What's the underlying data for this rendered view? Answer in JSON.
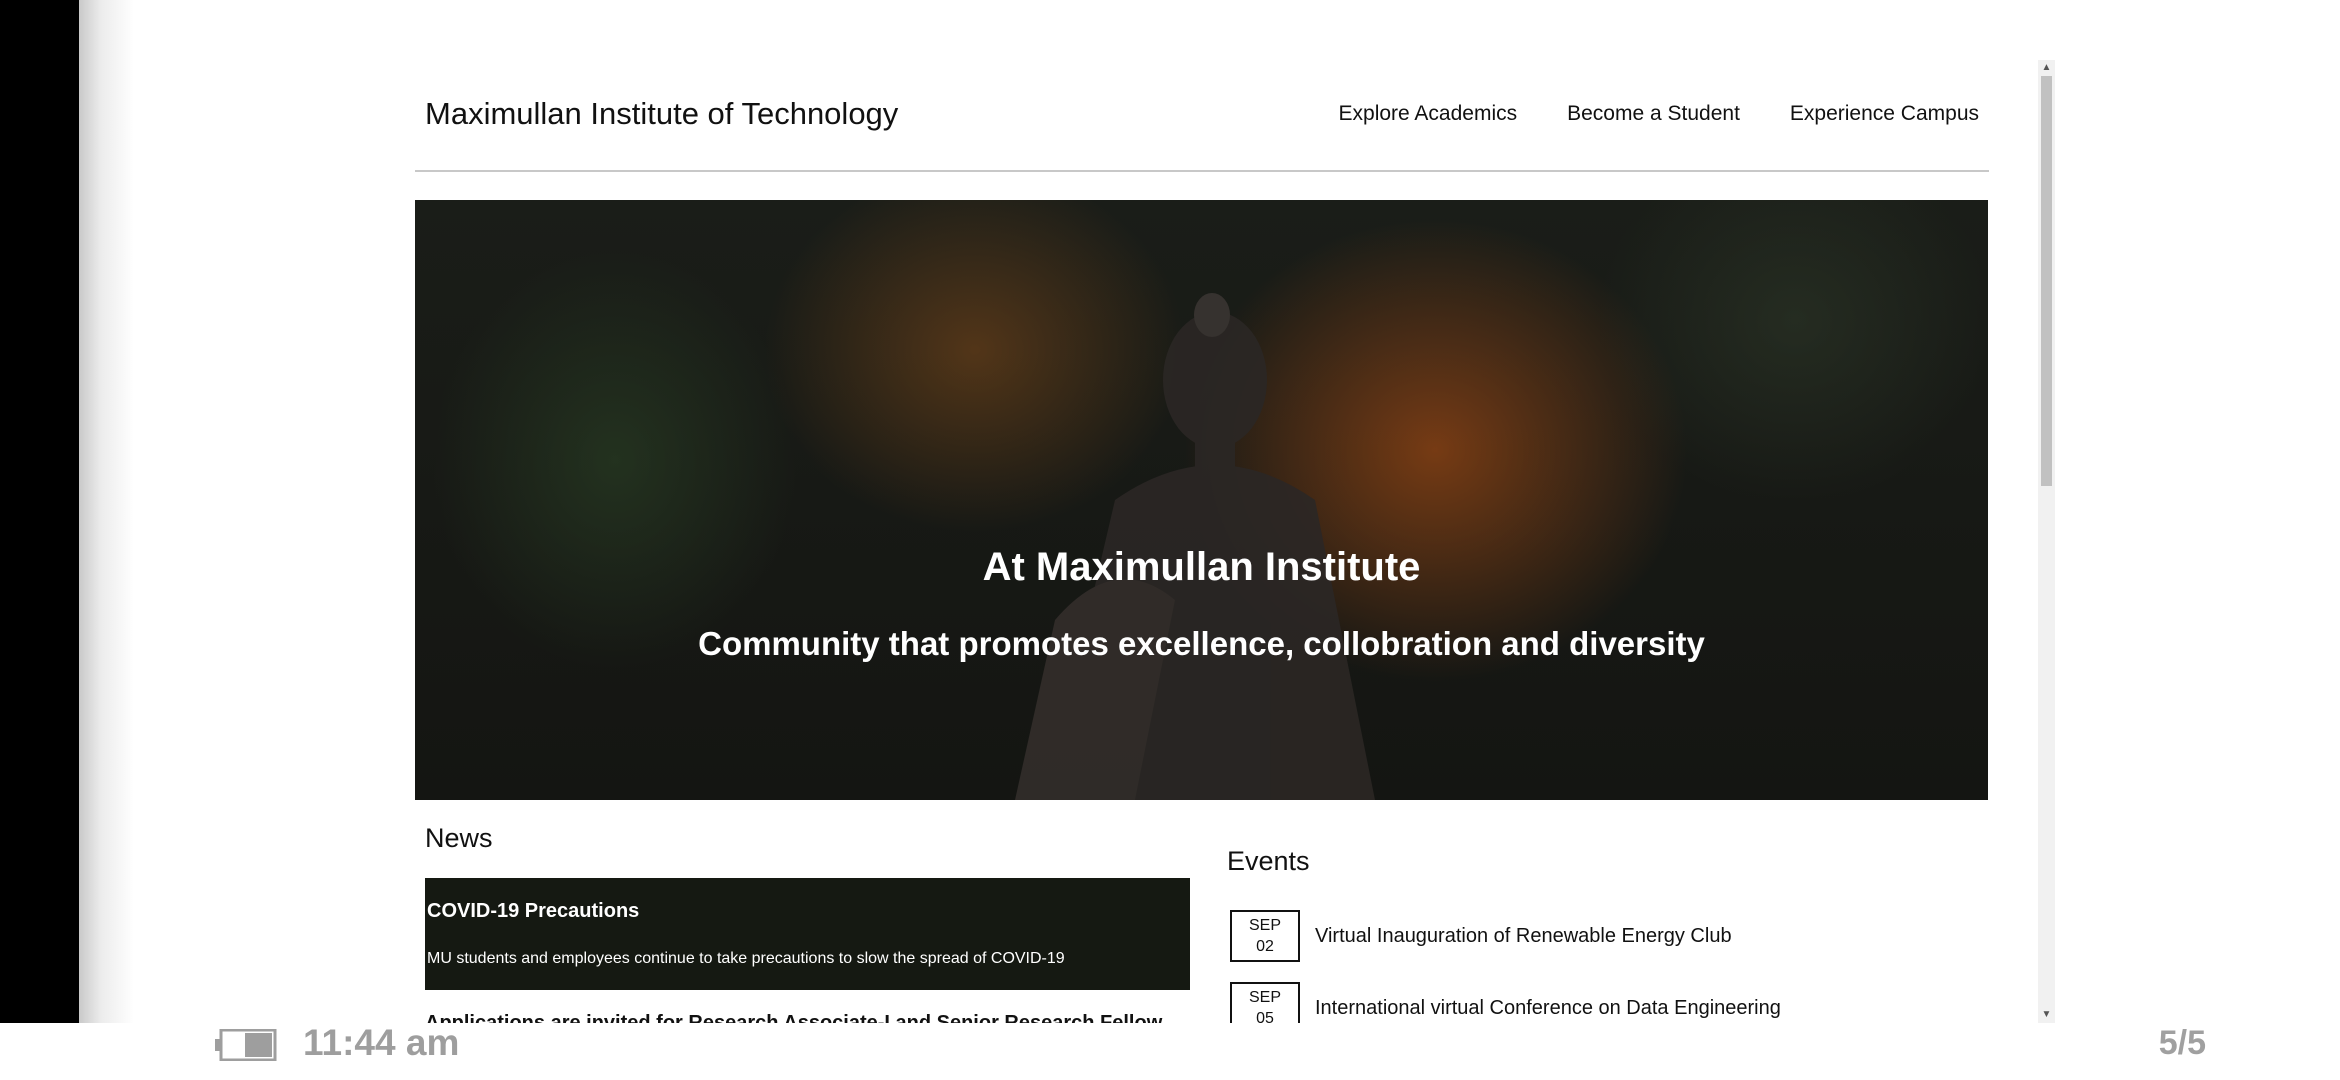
{
  "site": {
    "title": "Maximullan Institute of Technology",
    "nav": [
      "Explore Academics",
      "Become a Student",
      "Experience Campus"
    ]
  },
  "hero": {
    "title": "At Maximullan Institute",
    "subtitle": "Community that promotes excellence, collobration and diversity"
  },
  "news": {
    "heading": "News",
    "items": [
      {
        "title": "COVID-19 Precautions",
        "description": "MU students and employees continue to take precautions to slow the spread of COVID-19"
      },
      {
        "title": "Applications are invited for Research Associate-I and Senior Research Fellow"
      }
    ]
  },
  "events": {
    "heading": "Events",
    "items": [
      {
        "month": "SEP",
        "day": "02",
        "title": "Virtual Inauguration of Renewable Energy Club"
      },
      {
        "month": "SEP",
        "day": "05",
        "title": "International virtual Conference on Data Engineering"
      }
    ]
  },
  "status": {
    "time": "11:44  am",
    "page": "5/5",
    "battery_icon": "battery-icon"
  },
  "colors": {
    "news_card_bg": "#151912",
    "status_text": "#9e9e9e"
  }
}
